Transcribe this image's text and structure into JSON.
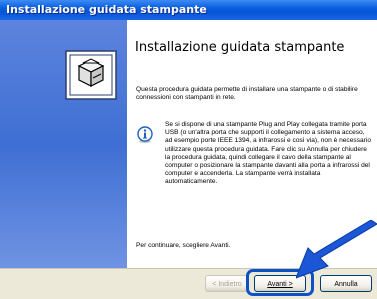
{
  "window": {
    "title": "Installazione guidata stampante"
  },
  "content": {
    "heading": "Installazione guidata stampante",
    "intro": "Questa procedura guidata permette di installare una stampante o di stabilire connessioni con stampanti in rete.",
    "note": "Se si dispone di una stampante Plug and Play collegata tramite porta USB (o un'altra porta che supporti il collegamento a sistema acceso, ad esempio porte IEEE 1394, a infrarossi e così via), non è necessario utilizzare questa procedura guidata. Fare clic su Annulla per chiudere la procedura guidata, quindi collegare il cavo della stampante al computer o posizionare la stampante davanti alla porta a infrarossi del computer e accenderla. La stampante verrà installata automaticamente.",
    "continue_text": "Per continuare, scegliere Avanti."
  },
  "buttons": {
    "back": "< Indietro",
    "next": "Avanti >",
    "cancel": "Annulla"
  },
  "icons": {
    "wizard": "printer-wizard-icon",
    "info": "info-icon",
    "pointer": "blue-arrow-pointer"
  },
  "colors": {
    "titlebar": "#0a5fe0",
    "left_panel": "#4a78d8",
    "highlight": "#0b52c9"
  }
}
